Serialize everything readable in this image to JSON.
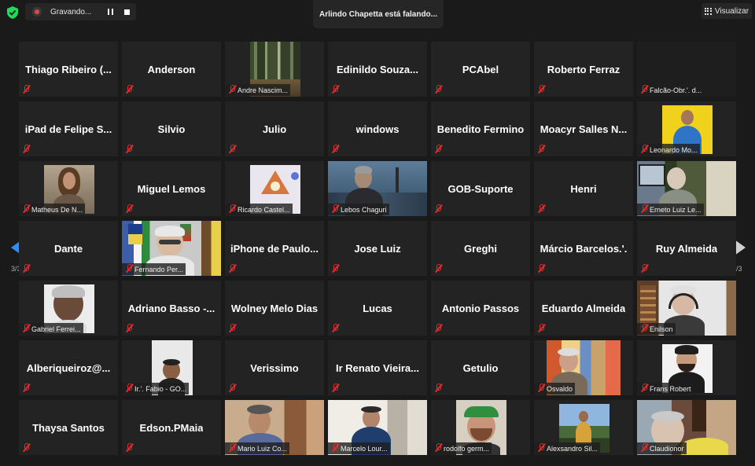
{
  "recording": {
    "label": "Gravando..."
  },
  "speaker_banner": "Arlindo Chapetta está falando...",
  "view_button": "Visualizar",
  "pagination": {
    "left": "3/3",
    "right": "3/3"
  },
  "tiles": [
    {
      "name": "Thiago Ribeiro (...",
      "label": "",
      "video": "none"
    },
    {
      "name": "Anderson",
      "label": "",
      "video": "none"
    },
    {
      "name": "",
      "label": "Andre Nascim...",
      "video": "forest"
    },
    {
      "name": "Edinildo Souza...",
      "label": "",
      "video": "none"
    },
    {
      "name": "PCAbel",
      "label": "",
      "video": "none"
    },
    {
      "name": "Roberto Ferraz",
      "label": "",
      "video": "none"
    },
    {
      "name": "",
      "label": "Falcão-Obr.'. d...",
      "video": "dark"
    },
    {
      "name": "iPad de Felipe S...",
      "label": "",
      "video": "none"
    },
    {
      "name": "Silvio",
      "label": "",
      "video": "none"
    },
    {
      "name": "Julio",
      "label": "",
      "video": "none"
    },
    {
      "name": "windows",
      "label": "",
      "video": "none"
    },
    {
      "name": "Benedito Fermino",
      "label": "",
      "video": "none"
    },
    {
      "name": "Moacyr Salles N...",
      "label": "",
      "video": "none"
    },
    {
      "name": "",
      "label": "Leonardo Mo...",
      "video": "yellow"
    },
    {
      "name": "",
      "label": "Matheus De N...",
      "video": "longhair"
    },
    {
      "name": "Miguel Lemos",
      "label": "",
      "video": "none"
    },
    {
      "name": "",
      "label": "Ricardo Castel...",
      "video": "emblem"
    },
    {
      "name": "",
      "label": "Lebos Chaguri",
      "video": "city"
    },
    {
      "name": "GOB-Suporte",
      "label": "",
      "video": "none"
    },
    {
      "name": "Henri",
      "label": "",
      "video": "none"
    },
    {
      "name": "",
      "label": "Erneto Luiz Le...",
      "video": "older"
    },
    {
      "name": "Dante",
      "label": "",
      "video": "none"
    },
    {
      "name": "",
      "label": "Fernando Per...",
      "video": "flags"
    },
    {
      "name": "iPhone de Paulo...",
      "label": "",
      "video": "none"
    },
    {
      "name": "Jose Luiz",
      "label": "",
      "video": "none"
    },
    {
      "name": "Greghi",
      "label": "",
      "video": "none"
    },
    {
      "name": "Márcio Barcelos.'.",
      "label": "",
      "video": "none"
    },
    {
      "name": "Ruy Almeida",
      "label": "",
      "video": "none"
    },
    {
      "name": "",
      "label": "Gabriel Ferrei...",
      "video": "portrait"
    },
    {
      "name": "Adriano Basso -...",
      "label": "",
      "video": "none"
    },
    {
      "name": "Wolney Melo Dias",
      "label": "",
      "video": "none"
    },
    {
      "name": "Lucas",
      "label": "",
      "video": "none"
    },
    {
      "name": "Antonio Passos",
      "label": "",
      "video": "none"
    },
    {
      "name": "Eduardo Almeida",
      "label": "",
      "video": "none"
    },
    {
      "name": "",
      "label": "Enilson",
      "video": "headset"
    },
    {
      "name": "Alberiqueiroz@...",
      "label": "",
      "video": "none"
    },
    {
      "name": "",
      "label": "Ir.'. Fabio - GO...",
      "video": "small"
    },
    {
      "name": "Verissimo",
      "label": "",
      "video": "none"
    },
    {
      "name": "Ir Renato Vieira...",
      "label": "",
      "video": "none"
    },
    {
      "name": "Getulio",
      "label": "",
      "video": "none"
    },
    {
      "name": "",
      "label": "Osvaldo",
      "video": "colorful"
    },
    {
      "name": "",
      "label": "Frans Robert",
      "video": "beard"
    },
    {
      "name": "Thaysa Santos",
      "label": "",
      "video": "none"
    },
    {
      "name": "Edson.PMaia",
      "label": "",
      "video": "none"
    },
    {
      "name": "",
      "label": "Mario Luiz Co...",
      "video": "warm"
    },
    {
      "name": "",
      "label": "Marcelo Lour...",
      "video": "curtain"
    },
    {
      "name": "",
      "label": "rodolfo germ...",
      "video": "cap"
    },
    {
      "name": "",
      "label": "Alexsandro Sil...",
      "video": "sky"
    },
    {
      "name": "",
      "label": "Claudionor",
      "video": "room"
    }
  ]
}
